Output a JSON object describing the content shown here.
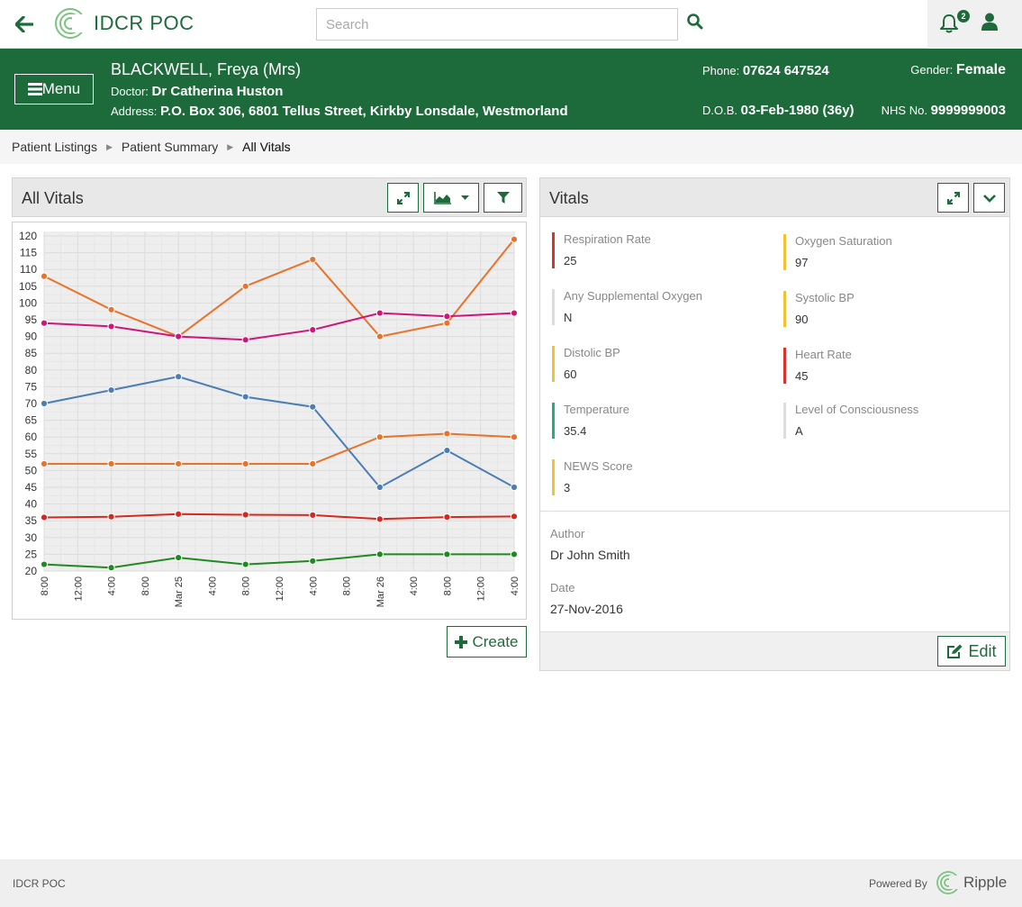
{
  "app": {
    "title": "IDCR POC"
  },
  "search": {
    "placeholder": "Search"
  },
  "notifications": {
    "count": "2"
  },
  "patient": {
    "name": "BLACKWELL, Freya (Mrs)",
    "doctor_label": "Doctor:",
    "doctor": "Dr Catherina Huston",
    "address_label": "Address:",
    "address": "P.O. Box 306, 6801 Tellus Street, Kirkby Lonsdale, Westmorland",
    "phone_label": "Phone:",
    "phone": "07624 647524",
    "gender_label": "Gender:",
    "gender": "Female",
    "dob_label": "D.O.B.",
    "dob": "03-Feb-1980 (36y)",
    "nhs_label": "NHS No.",
    "nhs": "9999999003"
  },
  "menu": {
    "label": "Menu"
  },
  "breadcrumb": [
    "Patient Listings",
    "Patient Summary",
    "All Vitals"
  ],
  "chart_panel": {
    "title": "All Vitals",
    "create_label": "Create"
  },
  "chart_data": {
    "type": "line",
    "title": "",
    "xlabel": "",
    "ylabel": "",
    "ylim": [
      20,
      120
    ],
    "y_ticks": [
      20,
      25,
      30,
      35,
      40,
      45,
      50,
      55,
      60,
      65,
      70,
      75,
      80,
      85,
      90,
      95,
      100,
      105,
      110,
      115,
      120
    ],
    "x_tick_labels": [
      "8:00",
      "12:00",
      "4:00",
      "8:00",
      "Mar 25",
      "4:00",
      "8:00",
      "12:00",
      "4:00",
      "8:00",
      "Mar 26",
      "4:00",
      "8:00",
      "12:00",
      "4:00"
    ],
    "grid": true,
    "series": [
      {
        "color": "#e8732a",
        "points": [
          [
            0,
            108
          ],
          [
            2,
            98
          ],
          [
            4,
            90
          ],
          [
            6,
            105
          ],
          [
            8,
            113
          ],
          [
            10,
            90
          ],
          [
            12,
            94
          ],
          [
            14,
            119
          ]
        ]
      },
      {
        "color": "#d0157a",
        "points": [
          [
            0,
            94
          ],
          [
            2,
            93
          ],
          [
            4,
            90
          ],
          [
            6,
            89
          ],
          [
            8,
            92
          ],
          [
            10,
            97
          ],
          [
            12,
            96
          ],
          [
            14,
            97
          ]
        ]
      },
      {
        "color": "#4a7eb5",
        "points": [
          [
            0,
            70
          ],
          [
            2,
            74
          ],
          [
            4,
            78
          ],
          [
            6,
            72
          ],
          [
            8,
            69
          ],
          [
            10,
            45
          ],
          [
            12,
            56
          ],
          [
            14,
            45
          ]
        ]
      },
      {
        "color": "#e8732a",
        "points": [
          [
            0,
            52
          ],
          [
            2,
            52
          ],
          [
            4,
            52
          ],
          [
            6,
            52
          ],
          [
            8,
            52
          ],
          [
            10,
            60
          ],
          [
            12,
            61
          ],
          [
            14,
            60
          ]
        ]
      },
      {
        "color": "#d4291f",
        "points": [
          [
            0,
            36
          ],
          [
            2,
            36.2
          ],
          [
            4,
            37
          ],
          [
            6,
            36.8
          ],
          [
            8,
            36.7
          ],
          [
            10,
            35.5
          ],
          [
            12,
            36.1
          ],
          [
            14,
            36.3
          ]
        ]
      },
      {
        "color": "#1f8a1f",
        "points": [
          [
            0,
            22
          ],
          [
            2,
            21
          ],
          [
            4,
            24
          ],
          [
            6,
            22
          ],
          [
            8,
            23
          ],
          [
            10,
            25
          ],
          [
            12,
            25
          ],
          [
            14,
            25
          ]
        ]
      }
    ]
  },
  "vitals_panel": {
    "title": "Vitals",
    "items": [
      {
        "label": "Respiration Rate",
        "value": "25",
        "color": "#d9342b"
      },
      {
        "label": "Oxygen Saturation",
        "value": "97",
        "color": "#f1c232"
      },
      {
        "label": "Any Supplemental Oxygen",
        "value": "N",
        "color": "#dddddd"
      },
      {
        "label": "Systolic BP",
        "value": "90",
        "color": "#f1c232"
      },
      {
        "label": "Distolic BP",
        "value": "60",
        "color": "#f1c232"
      },
      {
        "label": "Heart Rate",
        "value": "45",
        "color": "#d9342b"
      },
      {
        "label": "Temperature",
        "value": "35.4",
        "color": "#20b07a"
      },
      {
        "label": "Level of Consciousness",
        "value": "A",
        "color": "#dddddd"
      },
      {
        "label": "NEWS Score",
        "value": "3",
        "color": "#f1c232"
      }
    ],
    "author_label": "Author",
    "author": "Dr John Smith",
    "date_label": "Date",
    "date": "27-Nov-2016",
    "edit_label": "Edit"
  },
  "footer": {
    "left": "IDCR POC",
    "powered_by": "Powered By",
    "brand": "Ripple"
  },
  "colors": {
    "brand": "#1d6b3a"
  }
}
